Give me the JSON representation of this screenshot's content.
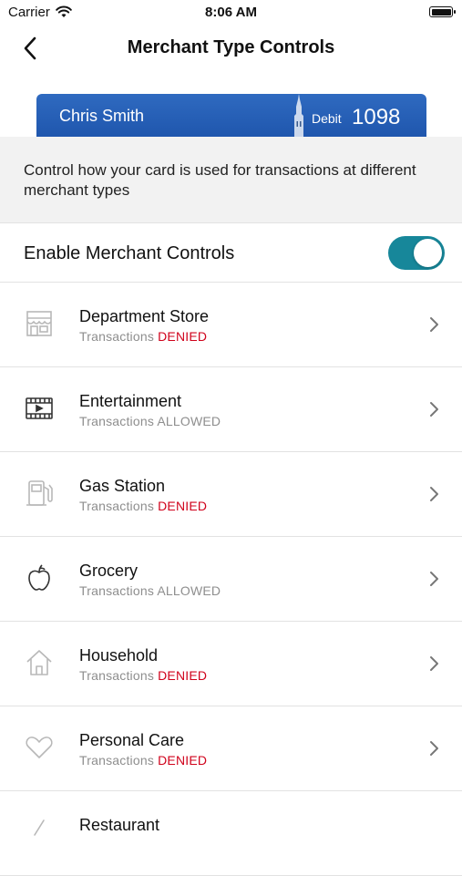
{
  "status_bar": {
    "carrier": "Carrier",
    "time": "8:06 AM"
  },
  "nav": {
    "title": "Merchant Type Controls"
  },
  "card": {
    "holder": "Chris Smith",
    "type": "Debit",
    "last4": "1098"
  },
  "description": "Control how your card is used for transactions at different merchant types",
  "enable_controls": {
    "label": "Enable Merchant Controls",
    "on": true,
    "accent": "#17879a"
  },
  "status_prefix": "Transactions",
  "merchants": [
    {
      "name": "Department Store",
      "status": "DENIED",
      "icon": "store-icon"
    },
    {
      "name": "Entertainment",
      "status": "ALLOWED",
      "icon": "film-icon"
    },
    {
      "name": "Gas Station",
      "status": "DENIED",
      "icon": "gas-pump-icon"
    },
    {
      "name": "Grocery",
      "status": "ALLOWED",
      "icon": "apple-icon"
    },
    {
      "name": "Household",
      "status": "DENIED",
      "icon": "house-icon"
    },
    {
      "name": "Personal Care",
      "status": "DENIED",
      "icon": "heart-icon"
    },
    {
      "name": "Restaurant",
      "status": "",
      "icon": "restaurant-icon"
    }
  ],
  "colors": {
    "denied": "#d0021b",
    "allowed_text": "#8e8e8e",
    "card_blue": "#2563b8"
  }
}
